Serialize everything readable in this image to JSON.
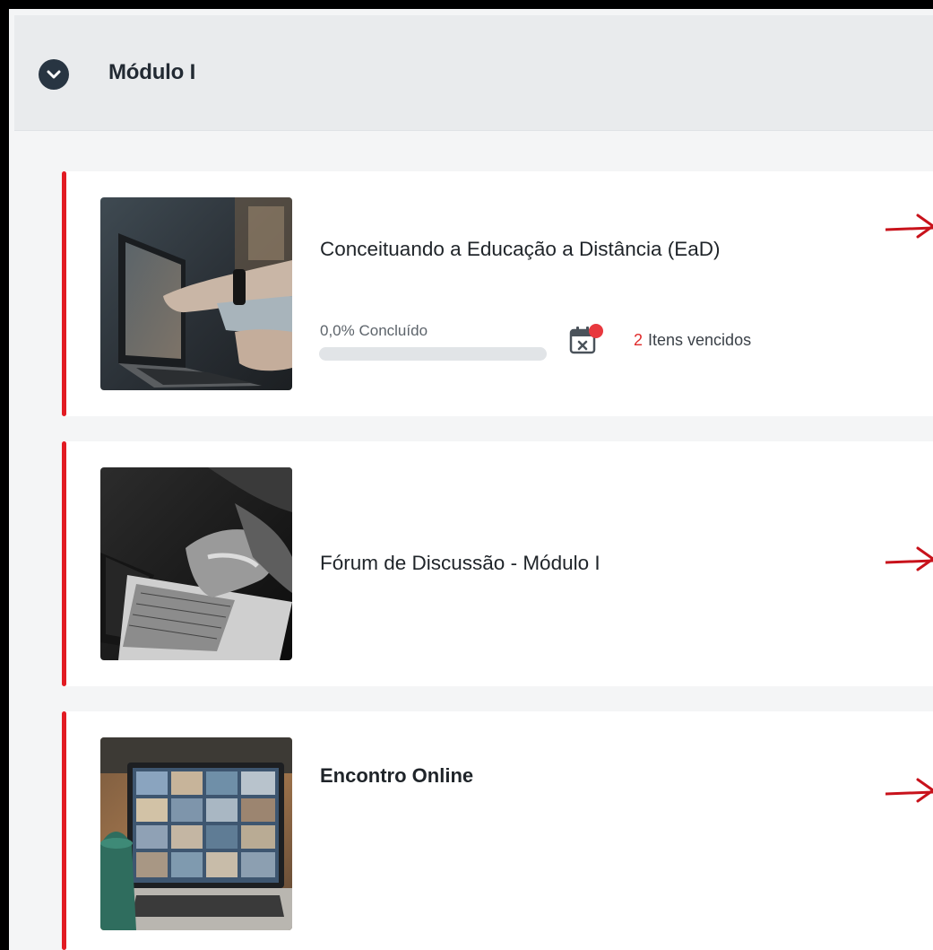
{
  "module": {
    "title": "Módulo I",
    "toggle_icon": "chevron-down-icon"
  },
  "items": [
    {
      "title": "Conceituando a Educação a Distância (EaD)",
      "thumbnail": "laptop-pointing-image",
      "progress": {
        "label": "0,0% Concluído",
        "percent": 0
      },
      "overdue": {
        "icon": "calendar-overdue-icon",
        "count": "2",
        "label": "Itens vencidos"
      }
    },
    {
      "title": "Fórum de Discussão - Módulo I",
      "thumbnail": "laptop-typing-image"
    },
    {
      "title": "Encontro Online",
      "thumbnail": "video-call-laptop-image"
    }
  ],
  "colors": {
    "accent_bar": "#e21b23",
    "annotation_arrow": "#c8121b",
    "overdue_count": "#e02b2b",
    "header_icon_bg": "#283542"
  },
  "annotations": [
    "arrow-icon",
    "arrow-icon",
    "arrow-icon"
  ]
}
